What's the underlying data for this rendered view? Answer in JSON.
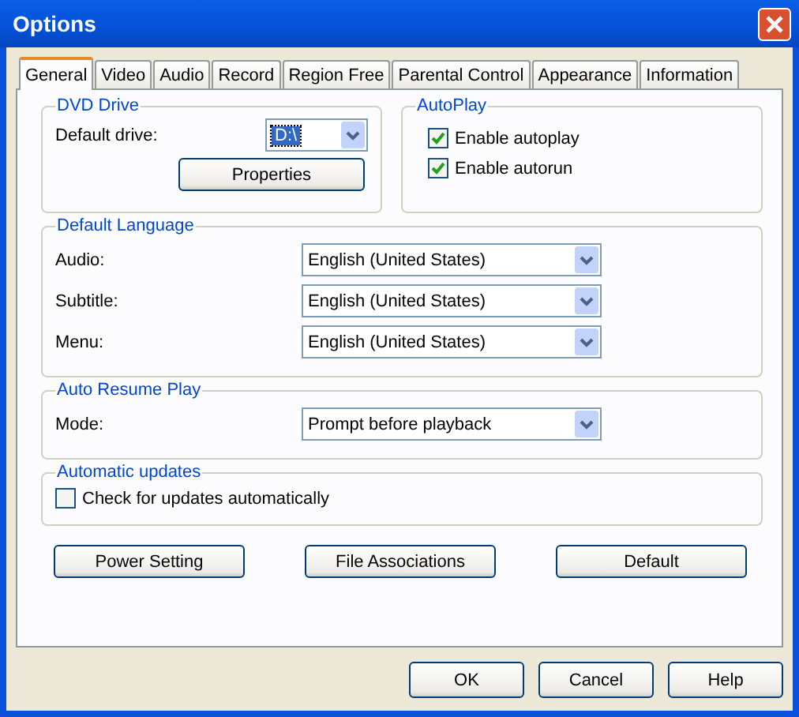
{
  "window": {
    "title": "Options"
  },
  "tabs": [
    {
      "label": "General",
      "selected": true
    },
    {
      "label": "Video",
      "selected": false
    },
    {
      "label": "Audio",
      "selected": false
    },
    {
      "label": "Record",
      "selected": false
    },
    {
      "label": "Region Free",
      "selected": false
    },
    {
      "label": "Parental Control",
      "selected": false
    },
    {
      "label": "Appearance",
      "selected": false
    },
    {
      "label": "Information",
      "selected": false
    }
  ],
  "dvd_drive": {
    "title": "DVD Drive",
    "label": "Default drive:",
    "value": "D:\\",
    "button": "Properties"
  },
  "autoplay": {
    "title": "AutoPlay",
    "options": [
      {
        "label": "Enable autoplay",
        "checked": true
      },
      {
        "label": "Enable autorun",
        "checked": true
      }
    ]
  },
  "default_language": {
    "title": "Default Language",
    "rows": [
      {
        "label": "Audio:",
        "value": "English (United States)"
      },
      {
        "label": "Subtitle:",
        "value": "English (United States)"
      },
      {
        "label": "Menu:",
        "value": "English (United States)"
      }
    ]
  },
  "auto_resume": {
    "title": "Auto Resume Play",
    "rows": [
      {
        "label": "Mode:",
        "value": "Prompt before playback"
      }
    ]
  },
  "updates": {
    "title": "Automatic updates",
    "options": [
      {
        "label": "Check for updates automatically",
        "checked": false
      }
    ]
  },
  "panel_buttons": [
    "Power Setting",
    "File Associations",
    "Default"
  ],
  "buttons": [
    "OK",
    "Cancel",
    "Help"
  ]
}
